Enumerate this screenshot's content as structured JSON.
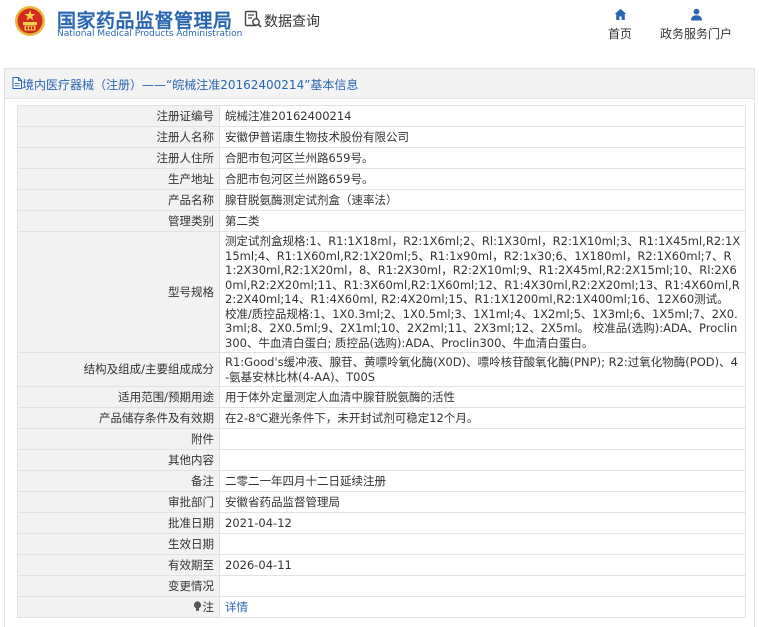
{
  "header": {
    "logo_cn": "国家药品监督管理局",
    "logo_en": "National Medical Products Administration",
    "db_title": "数据查询",
    "nav": [
      {
        "label": "首页",
        "icon": "home-icon"
      },
      {
        "label": "政务服务门户",
        "icon": "user-icon"
      }
    ],
    "brand_color": "#2966b2"
  },
  "breadcrumb": "境内医疗器械（注册）——“皖械注准20162400214”基本信息",
  "fields": [
    {
      "label": "注册证编号",
      "value": "皖械注准20162400214"
    },
    {
      "label": "注册人名称",
      "value": "安徽伊普诺康生物技术股份有限公司"
    },
    {
      "label": "注册人住所",
      "value": "合肥市包河区兰州路659号。"
    },
    {
      "label": "生产地址",
      "value": "合肥市包河区兰州路659号。"
    },
    {
      "label": "产品名称",
      "value": "腺苷脱氨酶测定试剂盒（速率法）"
    },
    {
      "label": "管理类别",
      "value": "第二类"
    },
    {
      "label": "型号规格",
      "value": "测定试剂盒规格:1、R1:1X18ml，R2:1X6ml;2、Rl:1X30ml，R2:1X10ml;3、R1:1X45ml,R2:1X15ml;4、R1:1X60ml,R2:1X20ml;5、R1:1x90ml，R2:1x30;6、1X180ml，R2:1X60ml;7、R1:2X30ml,R2:1X20ml，8、R1:2X30ml，R2:2X10ml;9、R1:2X45ml,R2:2X15ml;10、Rl:2X60ml,R2:2X20ml;11、R1:3X60ml,R2:1X60ml;12、R1:4X30ml,R2:2X20ml;13、R1:4X60ml,R2:2X40ml;14、R1:4X60ml, R2:4X20ml;15、R1:1X1200ml,R2:1X400ml;16、12X60测试。 校准/质控品规格:1、1X0.3ml;2、1X0.5ml;3、1X1ml;4、1X2ml;5、1X3ml;6、1X5ml;7、2X0.3ml;8、2X0.5ml;9、2X1ml;10、2X2ml;11、2X3ml;12、2X5ml。 校准品(选购):ADA、Proclin300、牛血清白蛋白; 质控品(选购):ADA、Proclin300、牛血清白蛋白。"
    },
    {
      "label": "结构及组成/主要组成成分",
      "value": "R1:Good's缓冲液、腺苷、黄嘌呤氧化酶(X0D)、嘌呤核苷酸氧化酶(PNP); R2:过氧化物酶(POD)、4-氨基安林比林(4-AA)、T00S"
    },
    {
      "label": "适用范围/预期用途",
      "value": "用于体外定量测定人血清中腺苷脱氨酶的活性"
    },
    {
      "label": "产品储存条件及有效期",
      "value": "在2-8℃避光条件下，未开封试剂可稳定12个月。"
    },
    {
      "label": "附件",
      "value": ""
    },
    {
      "label": "其他内容",
      "value": ""
    },
    {
      "label": "备注",
      "value": "二零二一年四月十二日延续注册"
    },
    {
      "label": "审批部门",
      "value": "安徽省药品监督管理局"
    },
    {
      "label": "批准日期",
      "value": "2021-04-12"
    },
    {
      "label": "生效日期",
      "value": ""
    },
    {
      "label": "有效期至",
      "value": "2026-04-11"
    },
    {
      "label": "变更情况",
      "value": ""
    },
    {
      "label": "注",
      "value": "详情",
      "icon": "lightbulb-icon"
    }
  ]
}
